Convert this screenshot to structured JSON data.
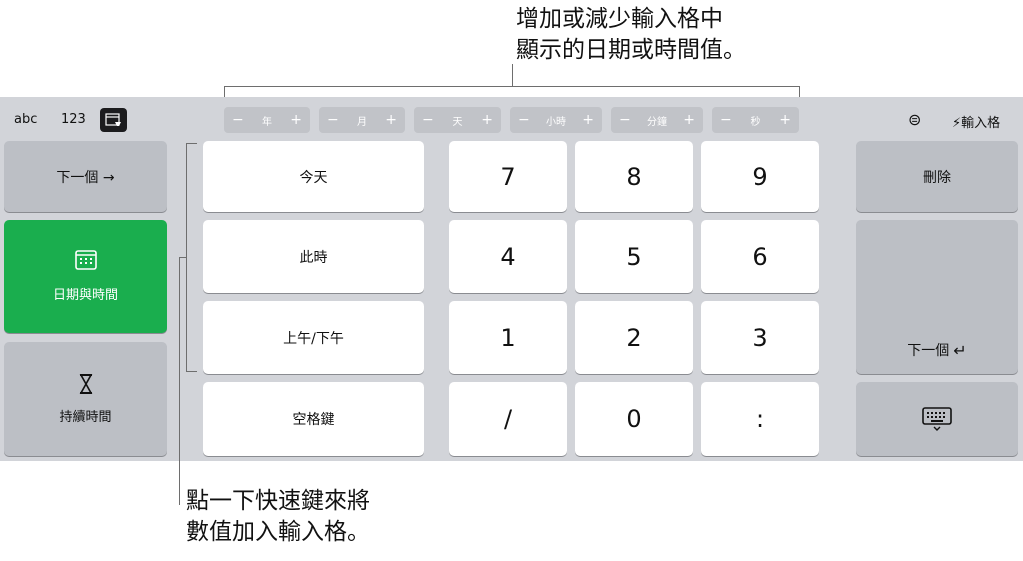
{
  "callouts": {
    "top_line1": "增加或減少輸入格中",
    "top_line2": "顯示的日期或時間值。",
    "bottom_line1": "點一下快速鍵來將",
    "bottom_line2": "數值加入輸入格。"
  },
  "topbar": {
    "abc": "abc",
    "num": "123",
    "steppers": [
      {
        "minus": "−",
        "label": "年",
        "plus": "+"
      },
      {
        "minus": "−",
        "label": "月",
        "plus": "+"
      },
      {
        "minus": "−",
        "label": "天",
        "plus": "+"
      },
      {
        "minus": "−",
        "label": "小時",
        "plus": "+"
      },
      {
        "minus": "−",
        "label": "分鐘",
        "plus": "+"
      },
      {
        "minus": "−",
        "label": "秒",
        "plus": "+"
      }
    ],
    "format_icon": "⊜",
    "enter_label": "輸入格"
  },
  "left": {
    "next": "下一個 →",
    "datetime": "日期與時間",
    "duration": "持續時間"
  },
  "shortcuts": [
    "今天",
    "此時",
    "上午/下午",
    "空格鍵"
  ],
  "digits": [
    [
      "7",
      "8",
      "9"
    ],
    [
      "4",
      "5",
      "6"
    ],
    [
      "1",
      "2",
      "3"
    ],
    [
      "/",
      "0",
      ":"
    ]
  ],
  "right": {
    "delete": "刪除",
    "next_return": "下一個"
  },
  "colors": {
    "keyboard_bg": "#d2d4d9",
    "accent_green": "#1aae4e",
    "key": "#ffffff",
    "key_dark": "#bcbfc5"
  }
}
